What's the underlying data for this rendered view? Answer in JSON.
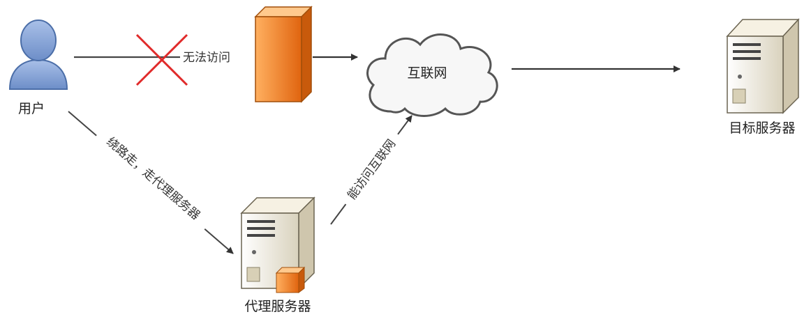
{
  "nodes": {
    "user": {
      "label": "用户",
      "icon": "user-icon"
    },
    "firewall": {
      "icon": "firewall-icon"
    },
    "internet": {
      "label": "互联网",
      "icon": "cloud-icon"
    },
    "target_server": {
      "label": "目标服务器",
      "icon": "server-icon"
    },
    "proxy_server": {
      "label": "代理服务器",
      "icon": "proxy-server-icon"
    }
  },
  "edges": {
    "blocked": {
      "label": "无法访问"
    },
    "detour": {
      "label": "绕路走，走代理服务器"
    },
    "proxy_to_internet": {
      "label": "能访问互联网"
    }
  },
  "colors": {
    "user_fill": "#7f9fd3",
    "firewall_fill": "#f07a1e",
    "blocked_mark": "#e02a2a",
    "server_body": "#efe8d4",
    "line": "#444444"
  }
}
